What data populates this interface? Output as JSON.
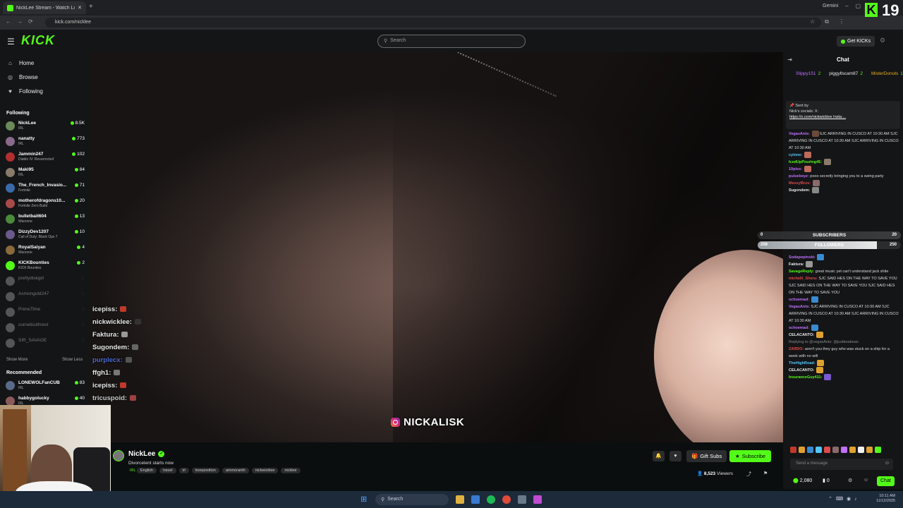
{
  "browser": {
    "tab_title": "NickLee Stream - Watch Li...",
    "new_tab": "+",
    "url": "kick.com/nicklee",
    "profile": "Gemini"
  },
  "overlay_badge": {
    "letter": "K",
    "count": "19"
  },
  "header": {
    "logo": "KICK",
    "search_placeholder": "Search",
    "get_kicks": "Get KICKs"
  },
  "sidebar": {
    "nav": [
      {
        "label": "Home",
        "icon": "home-icon"
      },
      {
        "label": "Browse",
        "icon": "compass-icon"
      },
      {
        "label": "Following",
        "icon": "heart-icon"
      }
    ],
    "following_header": "Following",
    "channels": [
      {
        "name": "NickLee",
        "game": "IRL",
        "viewers": "8.5K",
        "live": true,
        "color": "#6d8a5a"
      },
      {
        "name": "nanatty",
        "game": "IRL",
        "viewers": "773",
        "live": true,
        "color": "#8a6a8a"
      },
      {
        "name": "Jammin247",
        "game": "Diablo IV: Resurrected",
        "viewers": "102",
        "live": true,
        "color": "#b03030"
      },
      {
        "name": "Maki95",
        "game": "IRL",
        "viewers": "84",
        "live": true,
        "color": "#8a7a6a"
      },
      {
        "name": "The_French_Invasio...",
        "game": "Fortnite",
        "viewers": "71",
        "live": true,
        "color": "#3a6aa8"
      },
      {
        "name": "motherofdragons10...",
        "game": "Fortnite Zero Build",
        "viewers": "20",
        "live": true,
        "color": "#a84a4a"
      },
      {
        "name": "bulletbait604",
        "game": "Warzone",
        "viewers": "13",
        "live": true,
        "color": "#4a8a3a"
      },
      {
        "name": "DizzyDev1207",
        "game": "Call of Duty: Black Ops 7",
        "viewers": "10",
        "live": true,
        "color": "#6a5a8a"
      },
      {
        "name": "RoyalSaiyan",
        "game": "Warzone",
        "viewers": "4",
        "live": true,
        "color": "#8a6a3a"
      },
      {
        "name": "KICKBounties",
        "game": "KICK Bounties",
        "viewers": "2",
        "live": true,
        "color": "#53fc18"
      },
      {
        "name": "prettydiskgirl",
        "game": "",
        "viewers": "",
        "live": false,
        "color": "#555"
      },
      {
        "name": "Asmongold247",
        "game": "",
        "viewers": "",
        "live": false,
        "color": "#555"
      },
      {
        "name": "PrimeTime",
        "game": "",
        "viewers": "",
        "live": false,
        "color": "#555"
      },
      {
        "name": "cornelisuthrest",
        "game": "",
        "viewers": "",
        "live": false,
        "color": "#555"
      },
      {
        "name": "SIR_SAVAGE",
        "game": "",
        "viewers": "",
        "live": false,
        "color": "#555"
      }
    ],
    "show_more": "Show More",
    "show_less": "Show Less",
    "recommended_header": "Recommended",
    "recommended": [
      {
        "name": "LONEWOLFanCUB",
        "game": "IRL",
        "viewers": "83",
        "live": true,
        "color": "#5a6a8a"
      },
      {
        "name": "habbygolucky",
        "game": "IRL",
        "viewers": "40",
        "live": true,
        "color": "#8a5a5a"
      }
    ]
  },
  "overlay_chat": [
    {
      "user": "icepiss:",
      "color": "#e8e8e8",
      "emote": "#c0392b"
    },
    {
      "user": "nickwicklee:",
      "color": "#e8e8e8",
      "emote": "#333"
    },
    {
      "user": "Faktura:",
      "color": "#e8e8e8",
      "emote": "#999"
    },
    {
      "user": "Sugondem:",
      "color": "#e8e8e8",
      "emote": "#666"
    },
    {
      "user": "purplecx:",
      "color": "#4a6ad0",
      "emote": "#555"
    },
    {
      "user": "ffgh1:",
      "color": "#e8e8e8",
      "emote": "#777"
    },
    {
      "user": "icepiss:",
      "color": "#e8e8e8",
      "emote": "#c0392b"
    },
    {
      "user": "tricuspoid:",
      "color": "#c8c8c8",
      "emote": "#a04040"
    }
  ],
  "instagram_handle": "NICKALISK",
  "stream": {
    "streamer": "NickLee",
    "title": "Divorcelent starts now",
    "category": "IRL",
    "tags": [
      "English",
      "travel",
      "irl",
      "loseposition",
      "ammoranth",
      "nickwicklee",
      "nicklee"
    ],
    "gift_subs": "Gift Subs",
    "subscribe": "Subscribe",
    "viewers_count": "8,523",
    "viewers_label": "Viewers"
  },
  "chat": {
    "title": "Chat",
    "gift_leaders": [
      {
        "name": "Slippy151",
        "count": "2",
        "color": "#c070ff"
      },
      {
        "name": "piggyllscam87",
        "count": "2",
        "color": "#e8e8e8"
      },
      {
        "name": "MisterDonuts",
        "count": "1",
        "color": "#e8b020"
      }
    ],
    "pinned_header": "Sent by",
    "pinned_text": "Nick's socials: X:",
    "pinned_link": "https://x.com/nickwicklee Insta:...",
    "messages": [
      {
        "user": "VegasAnts:",
        "color": "#c070ff",
        "text": "SJC ARRIVING IN CUSCO AT 10:30 AM SJC ARRIVING IN CUSCO AT 10:30 AM SJC ARRIVING IN CUSCO AT 10:30 AM",
        "emote": "#6a4a3a"
      },
      {
        "user": "cylone:",
        "color": "#53c8ff",
        "text": "",
        "emote": "#c06a5a"
      },
      {
        "user": "IcedUpPouring45:",
        "color": "#53fc18",
        "text": "",
        "emote": "#8a7a6a"
      },
      {
        "user": "10piss:",
        "color": "#c070ff",
        "text": "",
        "emote": "#c06a5a"
      },
      {
        "user": "pulseboyz:",
        "color": "#c070ff",
        "text": "pooo secretly bringing you to a swing party",
        "emote": ""
      },
      {
        "user": "MessyBruv:",
        "color": "#e04a4a",
        "text": "",
        "emote": "#8a6a6a"
      },
      {
        "user": "Sugondem:",
        "color": "#e8e8e8",
        "text": "",
        "emote": "#888"
      }
    ],
    "messages2": [
      {
        "user": "Sodapopinski:",
        "color": "#c070ff",
        "text": "",
        "emote": "#3a8ad0"
      },
      {
        "user": "Faktura:",
        "color": "#e8e8e8",
        "text": "",
        "emote": "#999"
      },
      {
        "user": "SavageReply:",
        "color": "#53fc18",
        "text": "great music yet can't understand jack shite",
        "emote": ""
      },
      {
        "user": "michelli_Sheru:",
        "color": "#e04a4a",
        "text": "SJC SAID HES ON THE WAY TO SAVE YOU SJC SAID HES ON THE WAY TO SAVE YOU SJC SAID HES ON THE WAY TO SAVE YOU",
        "emote": ""
      },
      {
        "user": "schoemad:",
        "color": "#c070ff",
        "text": "",
        "emote": "#3a8ad0"
      },
      {
        "user": "VegasAnts:",
        "color": "#c070ff",
        "text": "SJC ARRIVING IN CUSCO AT 10:30 AM SJC ARRIVING IN CUSCO AT 10:30 AM SJC ARRIVING IN CUSCO AT 10:30 AM",
        "emote": ""
      },
      {
        "user": "schoemad:",
        "color": "#c070ff",
        "text": "",
        "emote": "#3a8ad0"
      },
      {
        "user": "CELACANTO:",
        "color": "#e8e8e8",
        "text": "",
        "emote": "#e0a030"
      },
      {
        "user": "ZARDO:",
        "color": "#e04a4a",
        "text": "aren't you they guy who was stuck on a ship for a week with no wifi",
        "emote": ""
      },
      {
        "user": "TheHighRoad:",
        "color": "#53c8ff",
        "text": "",
        "emote": "#e0a030"
      },
      {
        "user": "CELACANTO:",
        "color": "#e8e8e8",
        "text": "",
        "emote": "#e0a030"
      },
      {
        "user": "InsuranceGuy411:",
        "color": "#53fc18",
        "text": "",
        "emote": "#7a5ad0"
      }
    ],
    "replying_to": "Replying to @vegasAnts: @justbeabean",
    "subs_goal": {
      "label": "SUBSCRIBERS",
      "current": "0",
      "target": "20"
    },
    "followers_goal": {
      "label": "FOLLOWERS",
      "current": "208",
      "target": "250",
      "fraction": 0.832
    },
    "input_placeholder": "Send a message",
    "kicks_balance": "2,080",
    "tickets": "0",
    "chat_button": "Chat"
  },
  "taskbar": {
    "search": "Search",
    "time": "10:11 AM",
    "date": "11/12/2025"
  }
}
